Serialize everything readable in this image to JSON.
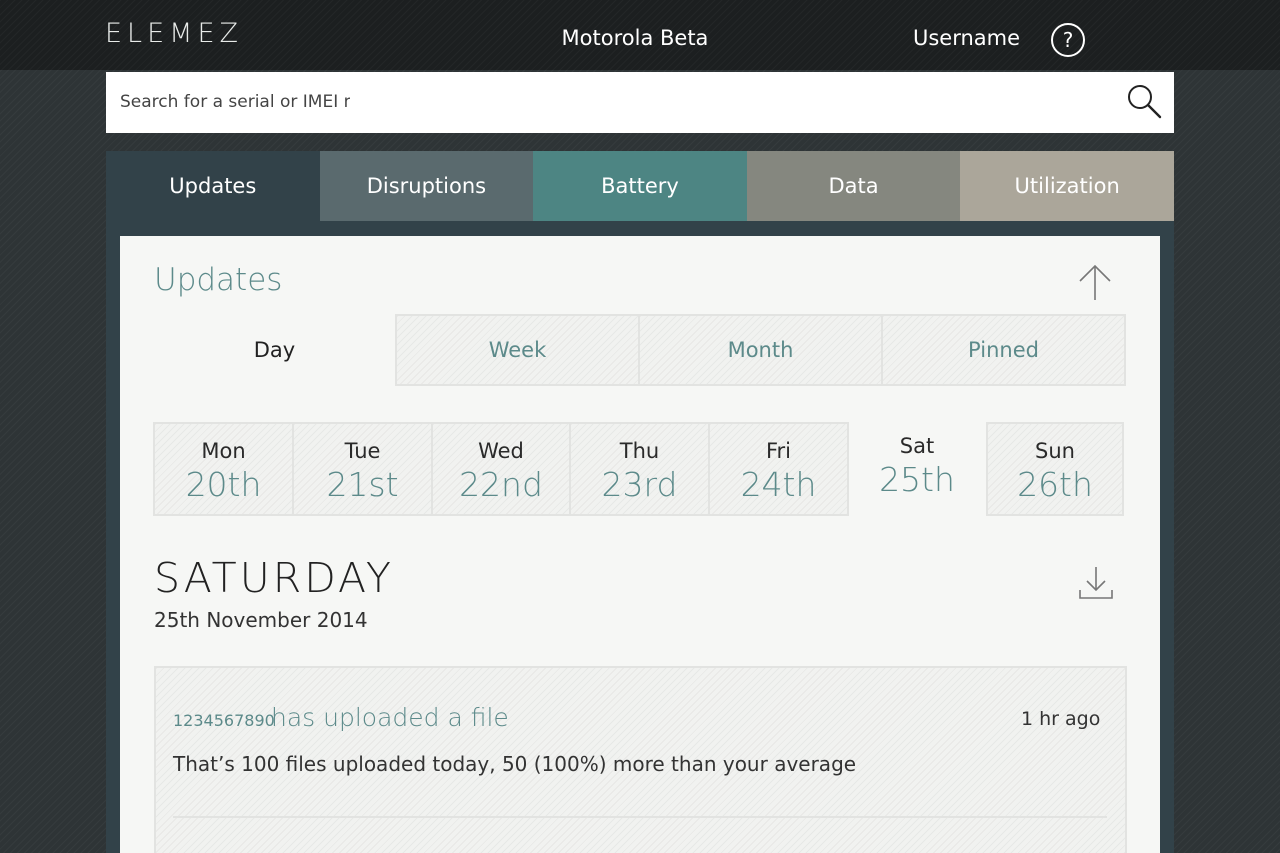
{
  "header": {
    "logo": "ELEMEZ",
    "app_title": "Motorola Beta",
    "username": "Username",
    "help_label": "?"
  },
  "search": {
    "placeholder": "Search for a serial or IMEI nu",
    "icon": "search-icon"
  },
  "tabs": [
    {
      "label": "Updates",
      "color": "#324249"
    },
    {
      "label": "Disruptions",
      "color": "#5a6a6e"
    },
    {
      "label": "Battery",
      "color": "#4d8583"
    },
    {
      "label": "Data",
      "color": "#85877f"
    },
    {
      "label": "Utilization",
      "color": "#aba69a"
    }
  ],
  "section": {
    "title": "Updates",
    "up_icon": "arrow-up-icon",
    "download_icon": "download-icon"
  },
  "range_tabs": [
    "Day",
    "Week",
    "Month",
    "Pinned"
  ],
  "days": [
    {
      "name": "Mon",
      "num": "20th"
    },
    {
      "name": "Tue",
      "num": "21st"
    },
    {
      "name": "Wed",
      "num": "22nd"
    },
    {
      "name": "Thu",
      "num": "23rd"
    },
    {
      "name": "Fri",
      "num": "24th"
    },
    {
      "name": "Sat",
      "num": "25th"
    },
    {
      "name": "Sun",
      "num": "26th"
    }
  ],
  "selected_day": {
    "heading": "SATURDAY",
    "date": "25th November 2014"
  },
  "feed": [
    {
      "serial": "1234567890",
      "action": "has uploaded a file",
      "time": "1 hr ago",
      "description": "That’s 100 files uploaded today, 50 (100%) more than your average"
    }
  ],
  "colors": {
    "accent": "#5c8a8a",
    "topbar": "#1c1f20",
    "panel": "#324249",
    "card": "#f6f7f5"
  }
}
